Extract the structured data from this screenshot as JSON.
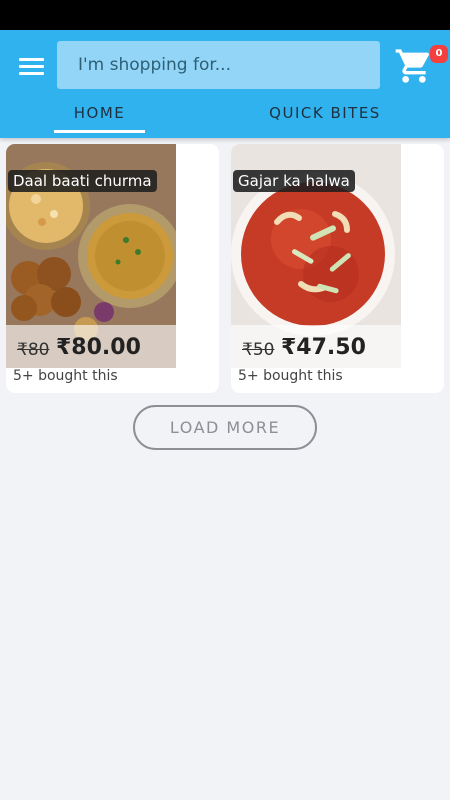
{
  "header": {
    "search_placeholder": "I'm shopping for...",
    "cart_count": "0",
    "tabs": [
      {
        "label": "HOME",
        "active": true
      },
      {
        "label": "QUICK BITES",
        "active": false
      }
    ]
  },
  "products": [
    {
      "name": "Daal baati churma",
      "old_price": "₹80",
      "price": "₹80.00",
      "bought": "5+ bought this"
    },
    {
      "name": "Gajar ka halwa",
      "old_price": "₹50",
      "price": "₹47.50",
      "bought": "5+ bought this"
    }
  ],
  "load_more_label": "LOAD MORE",
  "colors": {
    "header": "#2fb2ee",
    "badge": "#f43f3f",
    "background": "#f2f3f7"
  }
}
